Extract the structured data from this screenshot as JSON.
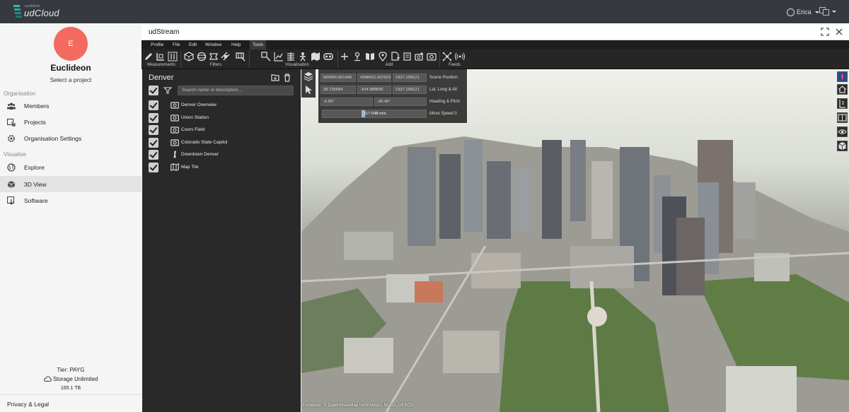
{
  "topbar": {
    "logo_small": "euclideon",
    "logo_name": "udCloud",
    "user_name": "Erica"
  },
  "sidebar": {
    "avatar_letter": "E",
    "org_name": "Euclideon",
    "select_project": "Select a project",
    "sections": {
      "organisation": "Organisation",
      "visualise": "Visualise"
    },
    "items": {
      "members": "Members",
      "projects": "Projects",
      "org_settings": "Organisation Settings",
      "explore": "Explore",
      "view3d": "3D View",
      "software": "Software"
    },
    "tier": "Tier: PAYG",
    "storage": "Storage Unlimited",
    "storage_used": "165.1 TB",
    "privacy": "Privacy & Legal"
  },
  "main": {
    "title": "udStream",
    "menu": [
      "Profile",
      "File",
      "Edit",
      "Window",
      "Help",
      "Tools"
    ],
    "toolbar_groups": {
      "measurements": "Measurements",
      "filters": "Filters",
      "visualisation": "Visualisation",
      "add": "Add",
      "feeds": "Feeds"
    }
  },
  "scene": {
    "title": "Denver",
    "search_placeholder": "Search name or description...",
    "items": [
      {
        "label": "Denver Overview",
        "icon": "camera-icon"
      },
      {
        "label": "Union Station",
        "icon": "camera-icon"
      },
      {
        "label": "Coors Field",
        "icon": "camera-icon"
      },
      {
        "label": "Colorado State Capitol",
        "icon": "camera-icon"
      },
      {
        "label": "Downtown Denver",
        "icon": "model-icon"
      },
      {
        "label": "Map Tile",
        "icon": "map-icon"
      }
    ]
  },
  "readout": {
    "scene_position": [
      "500956.601496",
      "4398421.507622",
      "1927.158121"
    ],
    "scene_position_label": "Scene Position",
    "latlong": [
      "39.735684",
      "-104.988836",
      "1927.158121"
    ],
    "latlong_label": "Lat, Long & Alt",
    "heading": "-6.55°",
    "pitch": "-26.40°",
    "heading_label": "Heading & Pitch",
    "speed": "117.048 m/s",
    "speed_fraction": 0.38,
    "speed_label": "Move Speed 0"
  },
  "viewport": {
    "attribution": "Euclideon, © OpenStreetMap contributors, NOAA, GEBCO"
  },
  "colors": {
    "topbar": "#363a3f",
    "avatar": "#f26b5e",
    "panel": "#292929",
    "logo_accent": "#2aa6a0"
  }
}
